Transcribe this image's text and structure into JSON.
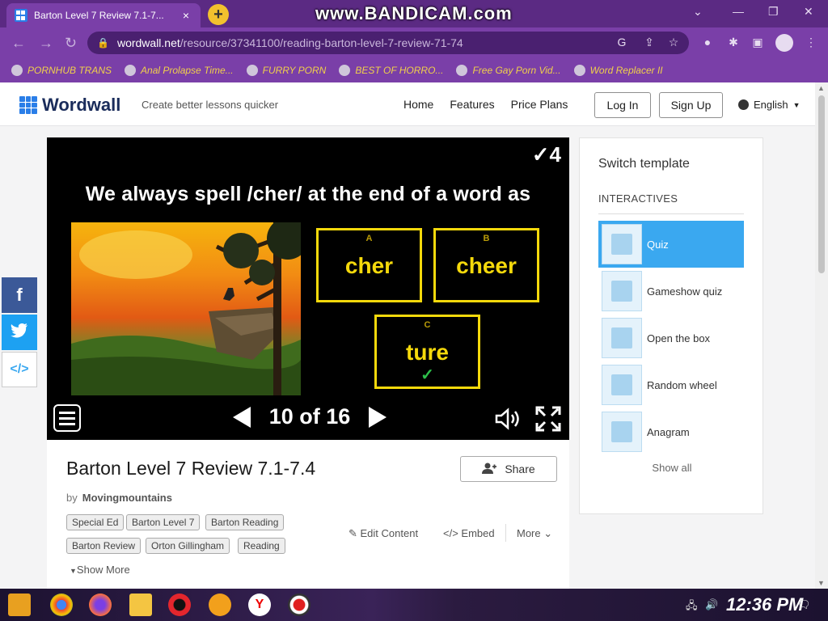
{
  "browser": {
    "tab_title": "Barton Level 7 Review 7.1-7...",
    "tab_close": "×",
    "new_tab": "+",
    "watermark": "www.BANDICAM.com",
    "url_host": "wordwall.net",
    "url_path": "/resource/37341100/reading-barton-level-7-review-71-74",
    "bookmarks": [
      "PORNHUB TRANS",
      "Anal Prolapse Time...",
      "FURRY PORN",
      "BEST OF HORRO...",
      "Free Gay Porn Vid...",
      "Word Replacer II"
    ]
  },
  "site": {
    "brand": "Wordwall",
    "tagline": "Create better lessons quicker",
    "nav": [
      "Home",
      "Features",
      "Price Plans"
    ],
    "login": "Log In",
    "signup": "Sign Up",
    "language": "English"
  },
  "game": {
    "score": "✓4",
    "question": "We always spell /cher/ at the end of a word as",
    "answers": [
      {
        "letter": "A",
        "word": "cher",
        "correct": false
      },
      {
        "letter": "B",
        "word": "cheer",
        "correct": false
      },
      {
        "letter": "C",
        "word": "ture",
        "correct": true
      }
    ],
    "correct_mark": "✓",
    "pager": "10 of 16"
  },
  "activity": {
    "title": "Barton Level 7 Review 7.1-7.4",
    "by_label": "by",
    "author": "Movingmountains",
    "share": "Share",
    "tags": [
      "Special Ed",
      "Barton Level 7",
      "Barton Reading",
      "Barton Review",
      "Orton Gillingham",
      "Reading"
    ],
    "edit": "Edit Content",
    "embed": "Embed",
    "more": "More",
    "show_more": "Show More"
  },
  "templates": {
    "title": "Switch template",
    "section": "INTERACTIVES",
    "items": [
      "Quiz",
      "Gameshow quiz",
      "Open the box",
      "Random wheel",
      "Anagram"
    ],
    "selected": "Quiz",
    "show_all": "Show all"
  },
  "social": {
    "facebook": "f",
    "twitter": "t",
    "embed": "</>"
  },
  "taskbar": {
    "time": "12:36 PM"
  },
  "colors": {
    "browser_frame": "#5b2a83",
    "accent_blue": "#3aa8f0",
    "answer_yellow": "#f5d90b",
    "correct_green": "#2dbf4a",
    "facebook": "#3b5998",
    "twitter": "#1da1f2"
  }
}
